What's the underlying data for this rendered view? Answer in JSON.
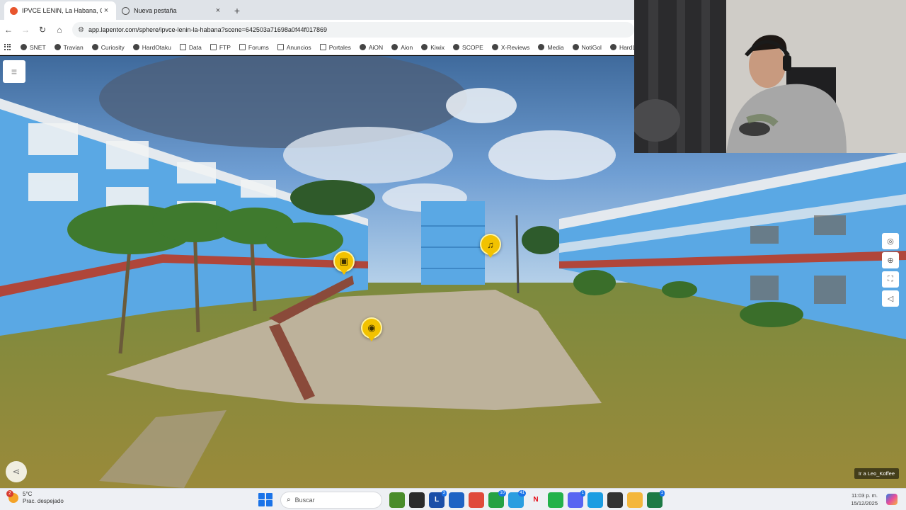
{
  "browser": {
    "tabs": [
      {
        "title": "IPVCE LENIN, La Habana, Cuba",
        "active": true,
        "icon": "lapentor-icon",
        "icon_color": "#e8552d"
      },
      {
        "title": "Nueva pestaña",
        "active": false,
        "icon": "globe-icon",
        "icon_color": "#555555"
      }
    ],
    "new_tab_label": "+",
    "close_label": "×",
    "url": "app.lapentor.com/sphere/ipvce-lenin-la-habana?scene=642503a71698a0f44f017869",
    "bookmarks": [
      {
        "label": "SNET",
        "icon": "globe"
      },
      {
        "label": "Travian",
        "icon": "globe"
      },
      {
        "label": "Curiosity",
        "icon": "globe"
      },
      {
        "label": "HardOtaku",
        "icon": "globe"
      },
      {
        "label": "Data",
        "icon": "folder"
      },
      {
        "label": "FTP",
        "icon": "folder"
      },
      {
        "label": "Forums",
        "icon": "folder"
      },
      {
        "label": "Anuncios",
        "icon": "folder"
      },
      {
        "label": "Portales",
        "icon": "folder"
      },
      {
        "label": "AiON",
        "icon": "globe"
      },
      {
        "label": "Aion",
        "icon": "globe"
      },
      {
        "label": "Kiwix",
        "icon": "globe"
      },
      {
        "label": "SCOPE",
        "icon": "globe"
      },
      {
        "label": "X-Reviews",
        "icon": "globe"
      },
      {
        "label": "Media",
        "icon": "globe"
      },
      {
        "label": "NotiGol",
        "icon": "globe"
      },
      {
        "label": "HardLin",
        "icon": "globe"
      }
    ]
  },
  "viewer": {
    "menu_icon": "hamburger-icon",
    "hotspots": [
      {
        "type": "image",
        "icon": "image-icon"
      },
      {
        "type": "audio",
        "icon": "music-note-icon"
      },
      {
        "type": "info",
        "icon": "chat-bubble-icon"
      }
    ],
    "controls": [
      "gyroscope-icon",
      "target-icon",
      "fullscreen-icon",
      "sound-icon"
    ],
    "next_scene_label": "Ir a Leo_Koffee",
    "accent_color": "#f2c200"
  },
  "taskbar": {
    "weather_temp": "5°C",
    "weather_desc": "Prac. despejado",
    "weather_badge": "2",
    "search_placeholder": "Buscar",
    "apps": [
      {
        "name": "tree-app-icon",
        "label": "",
        "color": "#4a8c2a"
      },
      {
        "name": "terminal-app-icon",
        "label": "",
        "color": "#2b2b2b"
      },
      {
        "name": "l-app-icon",
        "label": "L",
        "color": "#1b4fa8",
        "badge": "3"
      },
      {
        "name": "calendar-app-icon",
        "label": "",
        "color": "#1e63c4"
      },
      {
        "name": "chrome-app-icon",
        "label": "",
        "color": "#e04a3a"
      },
      {
        "name": "whatsapp-app-icon",
        "label": "",
        "color": "#25a244",
        "badge": "10"
      },
      {
        "name": "telegram-app-icon",
        "label": "",
        "color": "#2a9ee0",
        "badge": "41"
      },
      {
        "name": "netflix-app-icon",
        "label": "N",
        "color": "#eef0f4"
      },
      {
        "name": "alien-app-icon",
        "label": "",
        "color": "#23b24a"
      },
      {
        "name": "discord-app-icon",
        "label": "",
        "color": "#5865f2",
        "badge": "1"
      },
      {
        "name": "edge-app-icon",
        "label": "",
        "color": "#1b9de2"
      },
      {
        "name": "game-app-icon",
        "label": "",
        "color": "#333333"
      },
      {
        "name": "explorer-app-icon",
        "label": "",
        "color": "#f4b73c"
      },
      {
        "name": "excel-app-icon",
        "label": "",
        "color": "#1d7a45",
        "badge": "1"
      }
    ],
    "time": "11:03 p. m.",
    "date": "15/12/2025"
  }
}
